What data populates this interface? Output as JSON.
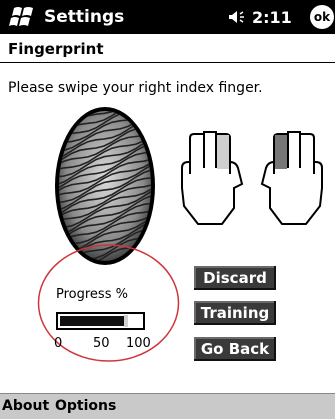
{
  "titlebar": {
    "app_title": "Settings",
    "time": "2:11",
    "ok_label": "ok",
    "start_icon": "windows-flag-icon",
    "volume_icon": "speaker-icon"
  },
  "page": {
    "title": "Fingerprint",
    "instruction": "Please swipe your right index finger."
  },
  "images": {
    "fingerprint": "fingerprint-scan-image",
    "left_hand": "left-hand-icon",
    "right_hand": "right-hand-icon",
    "selected_finger": "right-index"
  },
  "progress": {
    "label": "Progress %",
    "value": 82,
    "ticks": [
      "0",
      "50",
      "100"
    ],
    "highlight_color": "#d0343a"
  },
  "buttons": {
    "discard": "Discard",
    "training": "Training",
    "go_back": "Go Back"
  },
  "menu": {
    "about": "About",
    "options": "Options"
  }
}
